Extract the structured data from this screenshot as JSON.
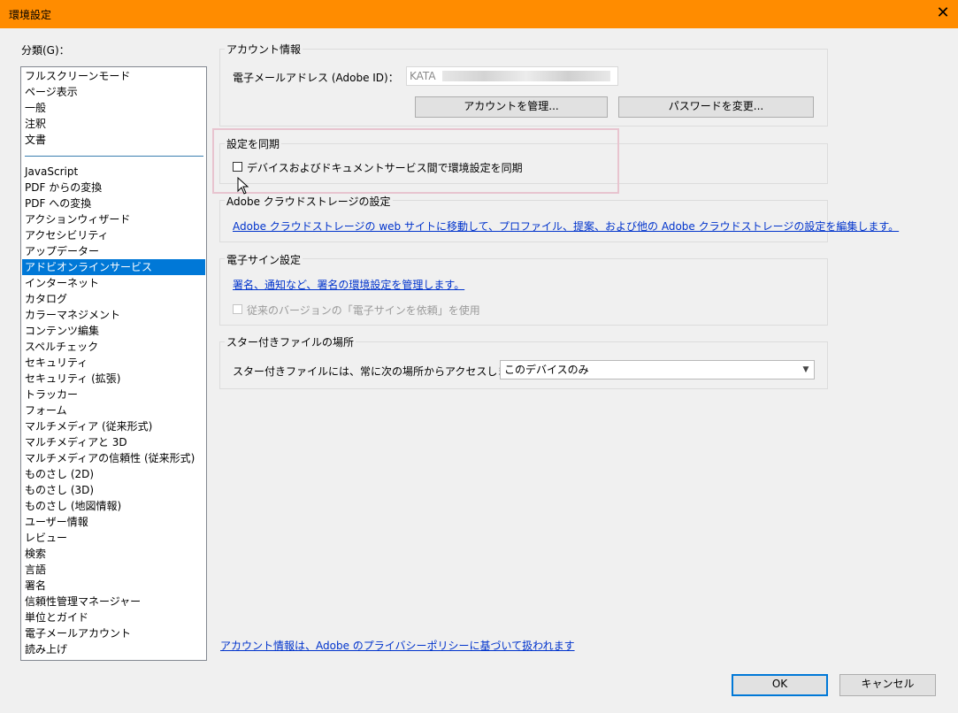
{
  "window": {
    "title": "環境設定",
    "close_label": "✕"
  },
  "categories": {
    "label": "分類(G)：",
    "group1": [
      "フルスクリーンモード",
      "ページ表示",
      "一般",
      "注釈",
      "文書"
    ],
    "group2": [
      "JavaScript",
      "PDF からの変換",
      "PDF への変換",
      "アクションウィザード",
      "アクセシビリティ",
      "アップデーター",
      "アドビオンラインサービス",
      "インターネット",
      "カタログ",
      "カラーマネジメント",
      "コンテンツ編集",
      "スペルチェック",
      "セキュリティ",
      "セキュリティ (拡張)",
      "トラッカー",
      "フォーム",
      "マルチメディア (従来形式)",
      "マルチメディアと 3D",
      "マルチメディアの信頼性 (従来形式)",
      "ものさし (2D)",
      "ものさし (3D)",
      "ものさし (地図情報)",
      "ユーザー情報",
      "レビュー",
      "検索",
      "言語",
      "署名",
      "信頼性管理マネージャー",
      "単位とガイド",
      "電子メールアカウント",
      "読み上げ"
    ],
    "selected": "アドビオンラインサービス"
  },
  "account": {
    "title": "アカウント情報",
    "email_label": "電子メールアドレス (Adobe ID)：",
    "email_value": "KATA",
    "manage_button": "アカウントを管理...",
    "password_button": "パスワードを変更..."
  },
  "sync": {
    "title": "設定を同期",
    "checkbox_label": "デバイスおよびドキュメントサービス間で環境設定を同期",
    "checked": false
  },
  "cloud": {
    "title": "Adobe クラウドストレージの設定",
    "link": "Adobe クラウドストレージの web サイトに移動して、プロファイル、提案、および他の Adobe クラウドストレージの設定を編集します。"
  },
  "esign": {
    "title": "電子サイン設定",
    "link": "署名、通知など、署名の環境設定を管理します。",
    "legacy_label": "従来のバージョンの「電子サインを依頼」を使用"
  },
  "starred": {
    "title": "スター付きファイルの場所",
    "label": "スター付きファイルには、常に次の場所からアクセスします...",
    "selected": "このデバイスのみ"
  },
  "footer": {
    "privacy_link": "アカウント情報は、Adobe のプライバシーポリシーに基づいて扱われます",
    "ok": "OK",
    "cancel": "キャンセル"
  },
  "colors": {
    "titlebar": "#ff8c00",
    "selection": "#0078d7",
    "link": "#0033cc",
    "highlight": "#e8c4cf"
  }
}
